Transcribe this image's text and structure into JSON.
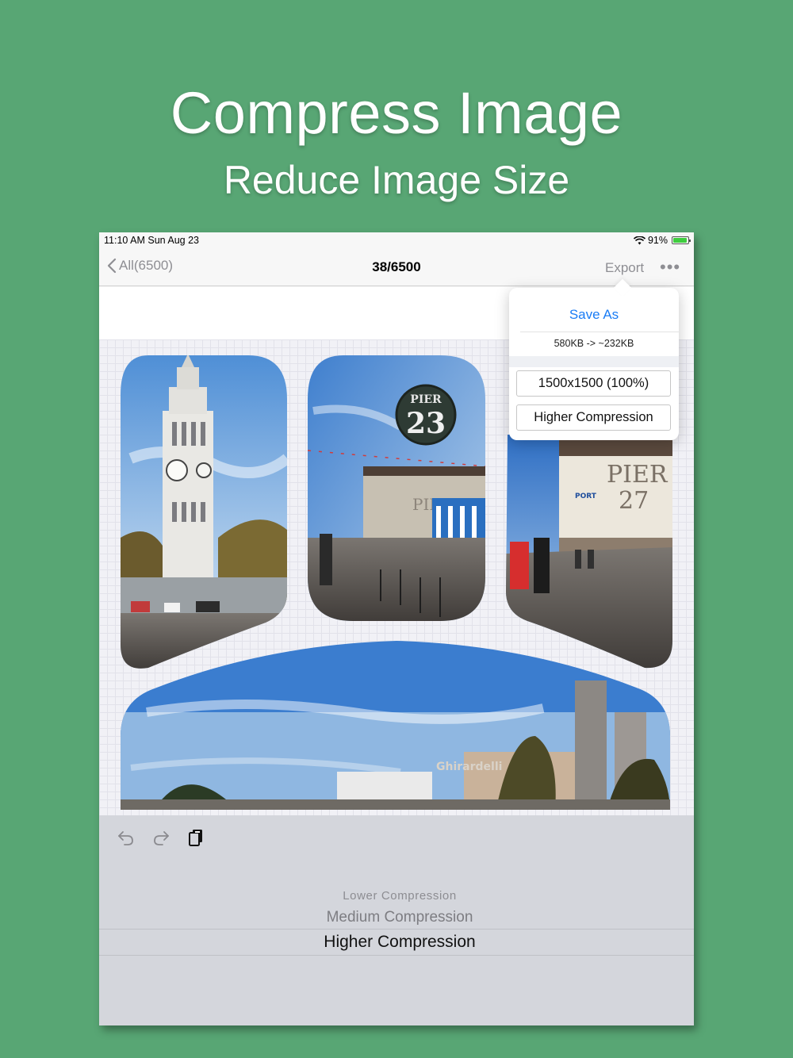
{
  "promo": {
    "title": "Compress Image",
    "subtitle": "Reduce Image Size"
  },
  "status_bar": {
    "time": "11:10 AM   Sun Aug 23",
    "battery": "91%",
    "battery_level": 0.91
  },
  "nav": {
    "back_label": "All(6500)",
    "title": "38/6500",
    "export_label": "Export",
    "more_label": "•••"
  },
  "popover": {
    "save_as_label": "Save As",
    "size_change": "580KB -> ~232KB",
    "resolution_button": "1500x1500 (100%)",
    "compression_button": "Higher Compression"
  },
  "collage": {
    "photos": [
      "ferry-building-clock-tower",
      "pier-23",
      "pier-27",
      "waterfront-panorama"
    ],
    "sign_pier23": "PIER 23",
    "sign_pier27": "PIER 27"
  },
  "toolbar": {
    "icons": [
      "undo-icon",
      "redo-icon",
      "copy-icon"
    ]
  },
  "compression_picker": {
    "options": [
      "Lower Compression",
      "Medium Compression",
      "Higher Compression"
    ],
    "selected": "Higher Compression"
  },
  "colors": {
    "background": "#58a674",
    "accent": "#1a7cf5"
  }
}
